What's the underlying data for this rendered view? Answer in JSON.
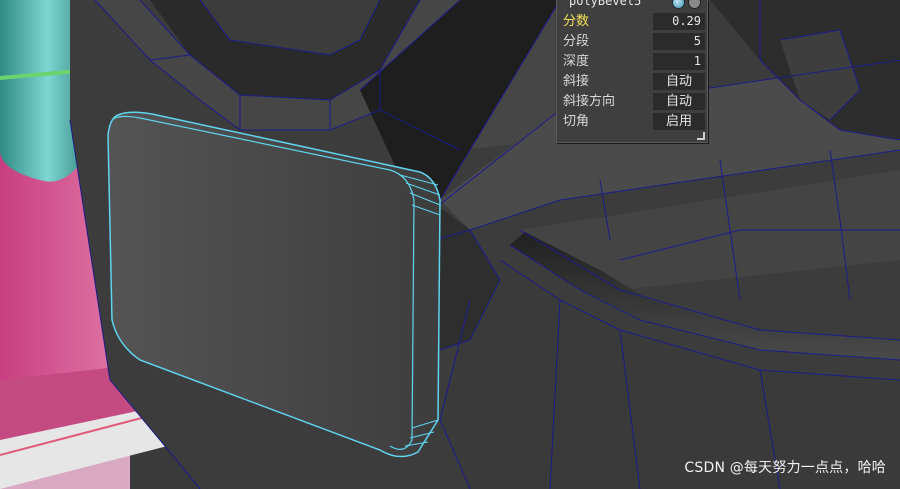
{
  "viewport": {
    "background": "#3a3a3a",
    "wireframe_color": "#1c1c8a",
    "selection_color": "#5fd4ef"
  },
  "attribute_panel": {
    "title": "polyBevel5",
    "icons": [
      "node-icon",
      "menu-icon"
    ],
    "rows": [
      {
        "label": "分数",
        "value": "0.29",
        "active": true
      },
      {
        "label": "分段",
        "value": "5",
        "active": false
      },
      {
        "label": "深度",
        "value": "1",
        "active": false
      },
      {
        "label": "斜接",
        "value": "自动",
        "active": false
      },
      {
        "label": "斜接方向",
        "value": "自动",
        "active": false
      },
      {
        "label": "切角",
        "value": "启用",
        "active": false
      }
    ],
    "active_label_color": "#f2e15a"
  },
  "watermark": "CSDN @每天努力一点点，哈哈"
}
